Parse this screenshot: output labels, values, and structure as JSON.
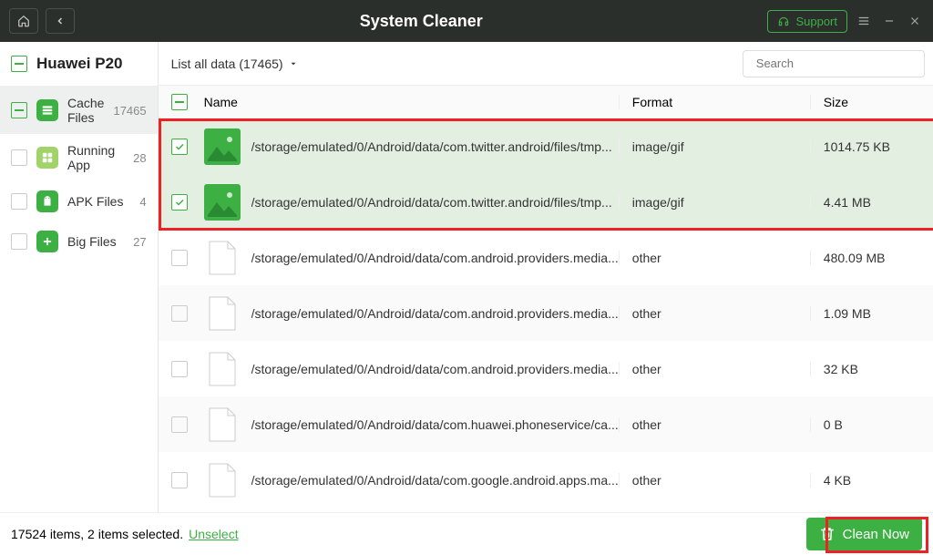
{
  "title": "System Cleaner",
  "support_label": "Support",
  "device_name": "Huawei P20",
  "filter_label": "List all data (17465)",
  "search_placeholder": "Search",
  "columns": {
    "name": "Name",
    "format": "Format",
    "size": "Size"
  },
  "sidebar": {
    "items": [
      {
        "label": "Cache Files",
        "count": "17465",
        "active": true,
        "checked": "minus",
        "icon": "cache"
      },
      {
        "label": "Running App",
        "count": "28",
        "active": false,
        "checked": "empty",
        "icon": "apps"
      },
      {
        "label": "APK Files",
        "count": "4",
        "active": false,
        "checked": "empty",
        "icon": "apk"
      },
      {
        "label": "Big Files",
        "count": "27",
        "active": false,
        "checked": "empty",
        "icon": "big"
      }
    ]
  },
  "rows": [
    {
      "path": "/storage/emulated/0/Android/data/com.twitter.android/files/tmp...",
      "format": "image/gif",
      "size": "1014.75 KB",
      "selected": true,
      "thumb": "image"
    },
    {
      "path": "/storage/emulated/0/Android/data/com.twitter.android/files/tmp...",
      "format": "image/gif",
      "size": "4.41 MB",
      "selected": true,
      "thumb": "image"
    },
    {
      "path": "/storage/emulated/0/Android/data/com.android.providers.media...",
      "format": "other",
      "size": "480.09 MB",
      "selected": false,
      "thumb": "file"
    },
    {
      "path": "/storage/emulated/0/Android/data/com.android.providers.media...",
      "format": "other",
      "size": "1.09 MB",
      "selected": false,
      "thumb": "file"
    },
    {
      "path": "/storage/emulated/0/Android/data/com.android.providers.media...",
      "format": "other",
      "size": "32 KB",
      "selected": false,
      "thumb": "file"
    },
    {
      "path": "/storage/emulated/0/Android/data/com.huawei.phoneservice/ca...",
      "format": "other",
      "size": "0 B",
      "selected": false,
      "thumb": "file"
    },
    {
      "path": "/storage/emulated/0/Android/data/com.google.android.apps.ma...",
      "format": "other",
      "size": "4 KB",
      "selected": false,
      "thumb": "file"
    }
  ],
  "footer": {
    "status": "17524 items, 2 items selected.",
    "unselect": "Unselect",
    "clean": "Clean Now"
  }
}
